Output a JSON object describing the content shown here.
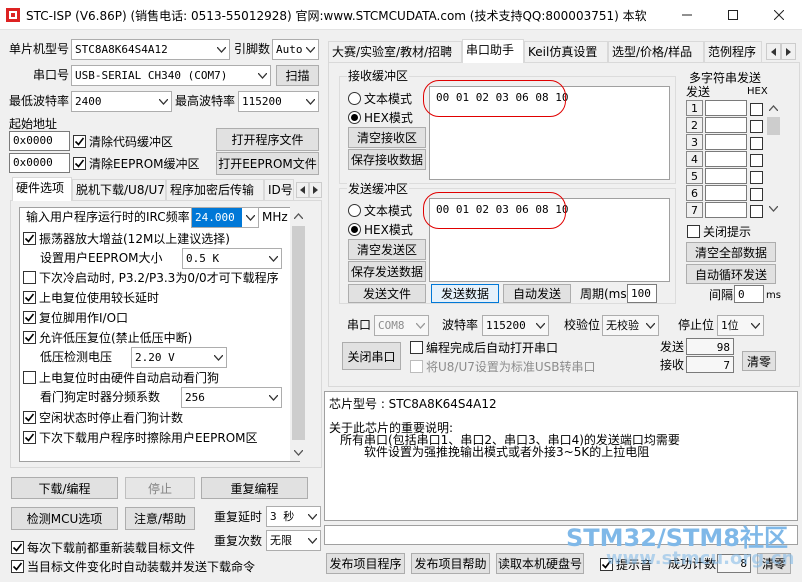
{
  "titlebar": {
    "title": "STC-ISP (V6.86P) (销售电话: 0513-55012928) 官网:www.STCMCUDATA.com  (技术支持QQ:800003751) 本软件..."
  },
  "left": {
    "mcu_label": "单片机型号",
    "mcu_value": "STC8A8K64S4A12",
    "pins_label": "引脚数",
    "pins_value": "Auto",
    "port_label": "串口号",
    "port_value": "USB-SERIAL CH340 (COM7)",
    "scan_btn": "扫描",
    "minbaud_label": "最低波特率",
    "minbaud_value": "2400",
    "maxbaud_label": "最高波特率",
    "maxbaud_value": "115200",
    "start_addr_label": "起始地址",
    "addr1": "0x0000",
    "clear_code": "清除代码缓冲区",
    "open_prog": "打开程序文件",
    "addr2": "0x0000",
    "clear_eeprom": "清除EEPROM缓冲区",
    "open_eeprom": "打开EEPROM文件",
    "tabs": [
      "硬件选项",
      "脱机下载/U8/U7",
      "程序加密后传输",
      "ID号"
    ],
    "irc_label": "输入用户程序运行时的IRC频率",
    "irc_value": "24.000",
    "irc_unit": "MHz",
    "opt1": "振荡器放大增益(12M以上建议选择)",
    "eeprom_size_label": "设置用户EEPROM大小",
    "eeprom_size_value": "0.5 K",
    "opt2": "下次冷启动时, P3.2/P3.3为0/0才可下载程序",
    "opt3": "上电复位使用较长延时",
    "opt4": "复位脚用作I/O口",
    "opt5": "允许低压复位(禁止低压中断)",
    "lvd_label": "低压检测电压",
    "lvd_value": "2.20 V",
    "opt6": "上电复位时由硬件自动启动看门狗",
    "wdt_label": "看门狗定时器分频系数",
    "wdt_value": "256",
    "opt7": "空闲状态时停止看门狗计数",
    "opt8": "下次下载用户程序时擦除用户EEPROM区",
    "download_btn": "下载/编程",
    "stop_btn": "停止",
    "reprog_btn": "重复编程",
    "check_btn": "检测MCU选项",
    "help_btn": "注意/帮助",
    "delay_label": "重复延时",
    "delay_value": "3 秒",
    "count_label": "重复次数",
    "count_value": "无限",
    "reload_opt": "每次下载前都重新装载目标文件",
    "auto_opt": "当目标文件变化时自动装载并发送下载命令"
  },
  "right": {
    "tabs": [
      "大赛/实验室/教材/招聘",
      "串口助手",
      "Keil仿真设置",
      "选型/价格/样品",
      "范例程序"
    ],
    "recv_group": "接收缓冲区",
    "text_mode": "文本模式",
    "hex_mode": "HEX模式",
    "clear_recv": "清空接收区",
    "save_recv": "保存接收数据",
    "recv_data": "00 01 02 03 06 08 10",
    "send_group": "发送缓冲区",
    "clear_send": "清空发送区",
    "save_send": "保存发送数据",
    "send_data": "00 01 02 03 06 08 10",
    "send_file": "发送文件",
    "send_data_btn": "发送数据",
    "auto_send": "自动发送",
    "period_label": "周期(ms)",
    "period_value": "100",
    "multi_title": "多字符串发送",
    "multi_send": "发送",
    "multi_hex": "HEX",
    "multi_nums": [
      "1",
      "2",
      "3",
      "4",
      "5",
      "6",
      "7"
    ],
    "close_hint": "关闭提示",
    "clear_all": "清空全部数据",
    "auto_loop": "自动循环发送",
    "interval_label": "间隔",
    "interval_value": "0",
    "interval_unit": "ms",
    "port_label": "串口",
    "port_value": "COM8",
    "baud_label": "波特率",
    "baud_value": "115200",
    "parity_label": "校验位",
    "parity_value": "无校验",
    "stop_label": "停止位",
    "stop_value": "1位",
    "close_port": "关闭串口",
    "auto_open": "编程完成后自动打开串口",
    "u8u7": "将U8/U7设置为标准USB转串口",
    "sent_label": "发送",
    "sent_value": "98",
    "recv_label": "接收",
    "recv_value": "7",
    "clear_btn": "清零",
    "info_line1": "芯片型号 : STC8A8K64S4A12",
    "info_line2": "关于此芯片的重要说明:",
    "info_line3": "所有串口(包括串口1、串口2、串口3、串口4)的发送端口均需要",
    "info_line4": "软件设置为强推挽输出模式或者外接3~5K的上拉电阻",
    "publish_prog": "发布项目程序",
    "publish_help": "发布项目帮助",
    "read_disk": "读取本机硬盘号",
    "hint_sound": "提示音",
    "success_label": "成功计数",
    "success_value": "8",
    "bottom_clear": "清零"
  },
  "watermark": {
    "line1": "STM32/STM8社区",
    "line2": "www.stmcu.org.cn"
  },
  "colors": {
    "accent": "#0078d7",
    "highlight": "#0078d7",
    "annotation": "#e00000"
  }
}
